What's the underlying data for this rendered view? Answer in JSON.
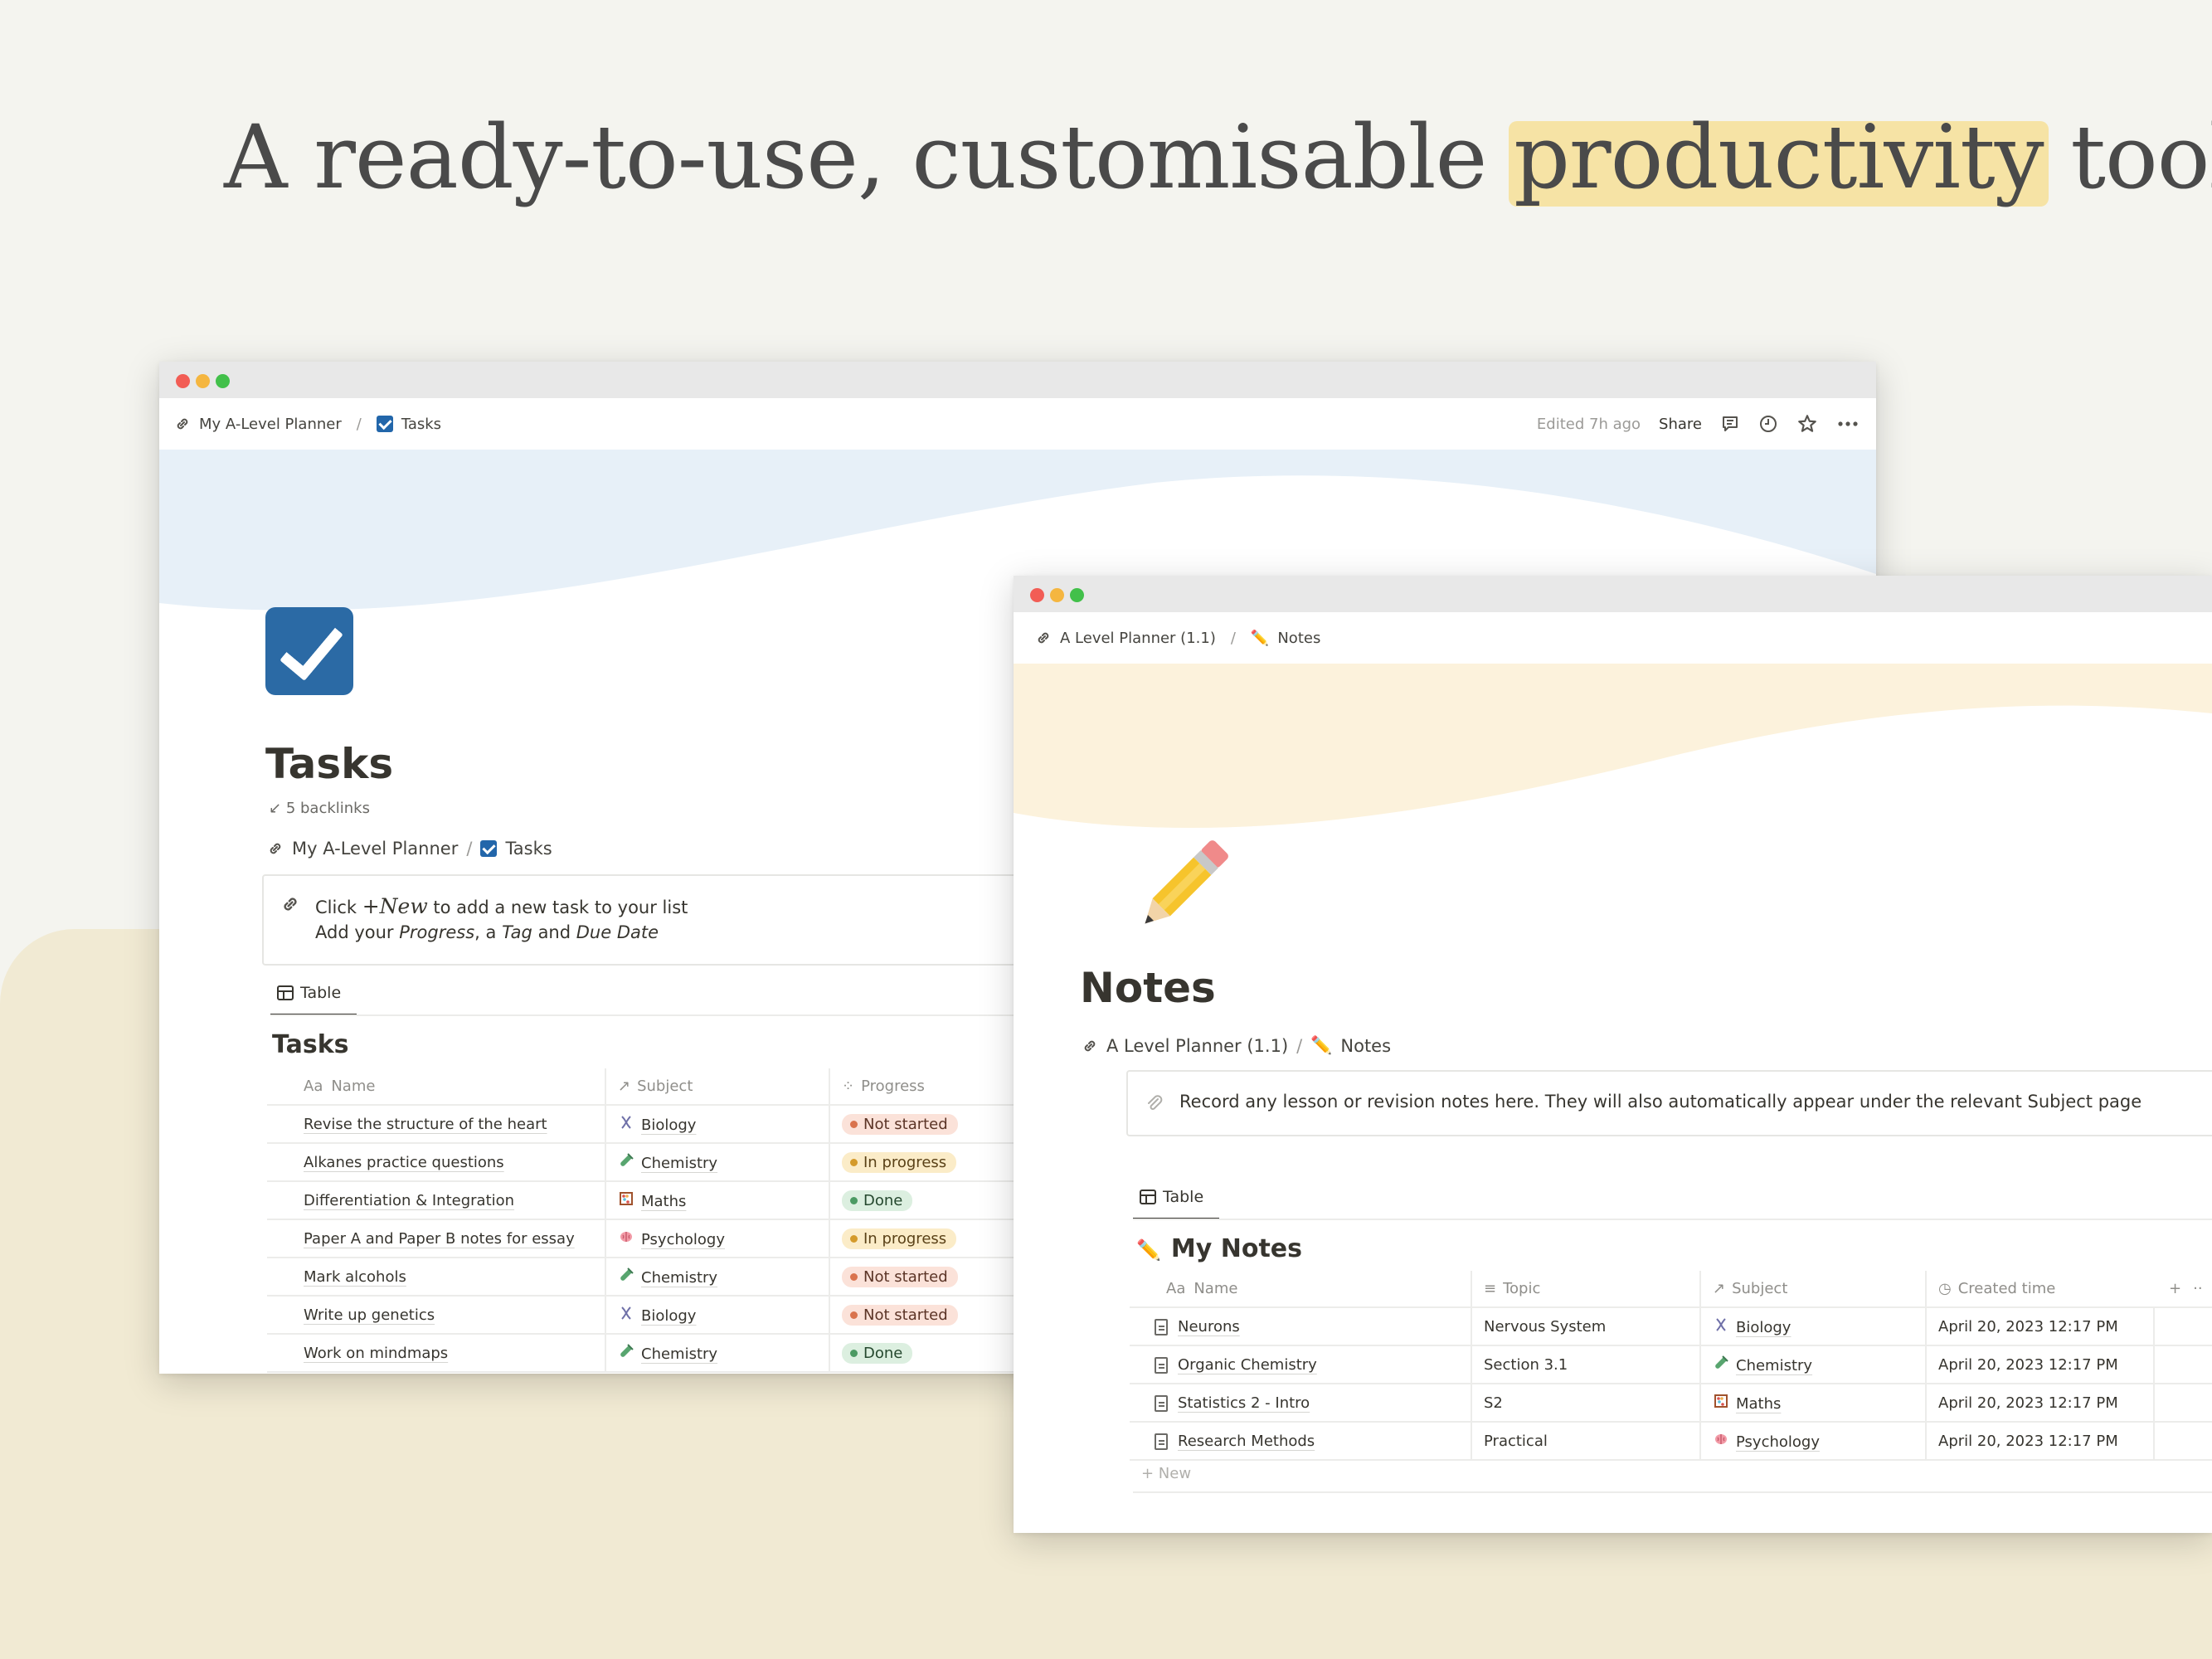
{
  "headline": {
    "before": "A ready-to-use, customisable ",
    "highlight": "productivity",
    "after": " tool"
  },
  "colors": {
    "accent_highlight": "#f5e1a0",
    "tasks_cover": "#e7f0f8",
    "notes_cover": "#fcf2dc",
    "beige_panel": "#f1ead3"
  },
  "tasks_window": {
    "breadcrumb": {
      "root": "My A-Level Planner",
      "sep": "/",
      "page": "Tasks"
    },
    "topbar": {
      "edited": "Edited 7h ago",
      "share": "Share"
    },
    "page_title": "Tasks",
    "backlinks": "5 backlinks",
    "inline_crumb": {
      "root": "My A-Level Planner",
      "sep": "/",
      "page": "Tasks"
    },
    "callout": {
      "line1_a": "Click ",
      "line1_new": "+New",
      "line1_b": " to add a new task to your list",
      "line2_a": "Add your ",
      "progress": "Progress",
      "line2_b": ", a ",
      "tag": "Tag",
      "line2_c": " and ",
      "due": "Due Date"
    },
    "tab": "Table",
    "db_title": "Tasks",
    "columns": {
      "name": "Name",
      "subject": "Subject",
      "progress": "Progress",
      "name_prefix": "Aa"
    },
    "rows": [
      {
        "name": "Revise the structure of the heart",
        "subject": "Biology",
        "subject_icon": "dna-icon",
        "progress": "Not started",
        "status": "not-started"
      },
      {
        "name": "Alkanes practice questions",
        "subject": "Chemistry",
        "subject_icon": "test-tube-icon",
        "progress": "In progress",
        "status": "in-progress"
      },
      {
        "name": "Differentiation & Integration",
        "subject": "Maths",
        "subject_icon": "abacus-icon",
        "progress": "Done",
        "status": "done"
      },
      {
        "name": "Paper A and Paper B notes for essay",
        "subject": "Psychology",
        "subject_icon": "brain-icon",
        "progress": "In progress",
        "status": "in-progress"
      },
      {
        "name": "Mark alcohols",
        "subject": "Chemistry",
        "subject_icon": "test-tube-icon",
        "progress": "Not started",
        "status": "not-started"
      },
      {
        "name": "Write up genetics",
        "subject": "Biology",
        "subject_icon": "dna-icon",
        "progress": "Not started",
        "status": "not-started"
      },
      {
        "name": "Work on mindmaps",
        "subject": "Chemistry",
        "subject_icon": "test-tube-icon",
        "progress": "Done",
        "status": "done"
      }
    ]
  },
  "notes_window": {
    "breadcrumb": {
      "root": "A Level Planner (1.1)",
      "sep": "/",
      "page": "Notes"
    },
    "page_title": "Notes",
    "inline_crumb": {
      "root": "A Level Planner (1.1)",
      "sep": "/",
      "page": "Notes"
    },
    "callout": "Record any lesson or revision notes here. They will also automatically appear under the relevant Subject page",
    "tab": "Table",
    "db_title": "My Notes",
    "columns": {
      "name_prefix": "Aa",
      "name": "Name",
      "topic": "Topic",
      "subject": "Subject",
      "created": "Created time",
      "add": "+",
      "more": "··"
    },
    "rows": [
      {
        "name": "Neurons",
        "topic": "Nervous System",
        "subject": "Biology",
        "subject_icon": "dna-icon",
        "created": "April 20, 2023 12:17 PM"
      },
      {
        "name": "Organic Chemistry",
        "topic": "Section 3.1",
        "subject": "Chemistry",
        "subject_icon": "test-tube-icon",
        "created": "April 20, 2023 12:17 PM"
      },
      {
        "name": "Statistics 2 - Intro",
        "topic": "S2",
        "subject": "Maths",
        "subject_icon": "abacus-icon",
        "created": "April 20, 2023 12:17 PM"
      },
      {
        "name": "Research Methods",
        "topic": "Practical",
        "subject": "Psychology",
        "subject_icon": "brain-icon",
        "created": "April 20, 2023 12:17 PM"
      }
    ],
    "new_row": "+ New"
  }
}
